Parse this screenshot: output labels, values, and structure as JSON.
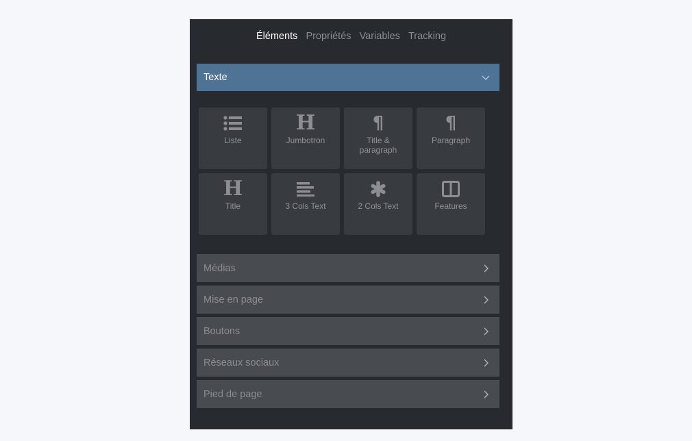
{
  "tabs": [
    {
      "label": "Éléments",
      "active": true
    },
    {
      "label": "Propriétés",
      "active": false
    },
    {
      "label": "Variables",
      "active": false
    },
    {
      "label": "Tracking",
      "active": false
    }
  ],
  "section": {
    "title": "Texte",
    "expanded": true,
    "icon": "chevron-down-icon",
    "color": "#4f7395"
  },
  "tiles": [
    {
      "label": "Liste",
      "icon": "list-icon"
    },
    {
      "label": "Jumbotron",
      "icon": "heading-icon"
    },
    {
      "label": "Title & paragraph",
      "icon": "paragraph-icon"
    },
    {
      "label": "Paragraph",
      "icon": "paragraph-icon"
    },
    {
      "label": "Title",
      "icon": "heading-icon"
    },
    {
      "label": "3 Cols Text",
      "icon": "align-left-icon"
    },
    {
      "label": "2 Cols Text",
      "icon": "asterisk-icon"
    },
    {
      "label": "Features",
      "icon": "columns-icon"
    }
  ],
  "accordion": [
    {
      "label": "Médias",
      "icon": "chevron-right-icon"
    },
    {
      "label": "Mise en page",
      "icon": "chevron-right-icon"
    },
    {
      "label": "Boutons",
      "icon": "chevron-right-icon"
    },
    {
      "label": "Réseaux sociaux",
      "icon": "chevron-right-icon"
    },
    {
      "label": "Pied de page",
      "icon": "chevron-right-icon"
    }
  ]
}
